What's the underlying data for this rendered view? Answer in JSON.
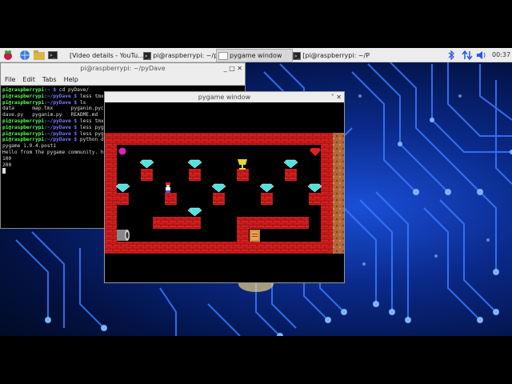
{
  "taskbar": {
    "tasks": [
      {
        "label": "[Video details - YouTu..."
      },
      {
        "label": "pi@raspberrypi: ~/py..."
      },
      {
        "label": "pygame window"
      },
      {
        "label": "[pi@raspberrypi: ~/Pi..."
      }
    ],
    "clock": "00:37",
    "icons": [
      "raspberry-menu-icon",
      "browser-globe-icon",
      "file-manager-icon",
      "terminal-icon",
      "bluetooth-icon",
      "network-arrows-icon",
      "volume-icon"
    ]
  },
  "terminal": {
    "title": "pi@raspberrypi: ~/pyDave",
    "menu": [
      "File",
      "Edit",
      "Tabs",
      "Help"
    ],
    "prompt": "pi@raspberrypi",
    "lines": [
      {
        "path": ":~ $",
        "cmd": " cd pyDave/"
      },
      {
        "path": ":~/pyDave $",
        "cmd": " less tmx"
      },
      {
        "path": ":~/pyDave $",
        "cmd": " ls"
      },
      {
        "out": "data      map.tmx      pyganim.pyc"
      },
      {
        "out": "dave.py   pyganim.py   README.md"
      },
      {
        "path": ":~/pyDave $",
        "cmd": " less tmx"
      },
      {
        "path": ":~/pyDave $",
        "cmd": " less pyg"
      },
      {
        "path": ":~/pyDave $",
        "cmd": " less pyg"
      },
      {
        "path": ":~/pyDave $",
        "cmd": " python d"
      },
      {
        "out": "pygame 1.9.4.post1"
      },
      {
        "out": "Hello from the pygame community. h"
      },
      {
        "out": "100"
      },
      {
        "out": "200"
      }
    ]
  },
  "pygame": {
    "title": "pygame window"
  },
  "colors": {
    "brick": "#d42020",
    "brick_dark": "#8a0a0a",
    "dirt": "#b06a3a",
    "diamond": "#4fe3e0",
    "circuit": "#2a6bff"
  }
}
